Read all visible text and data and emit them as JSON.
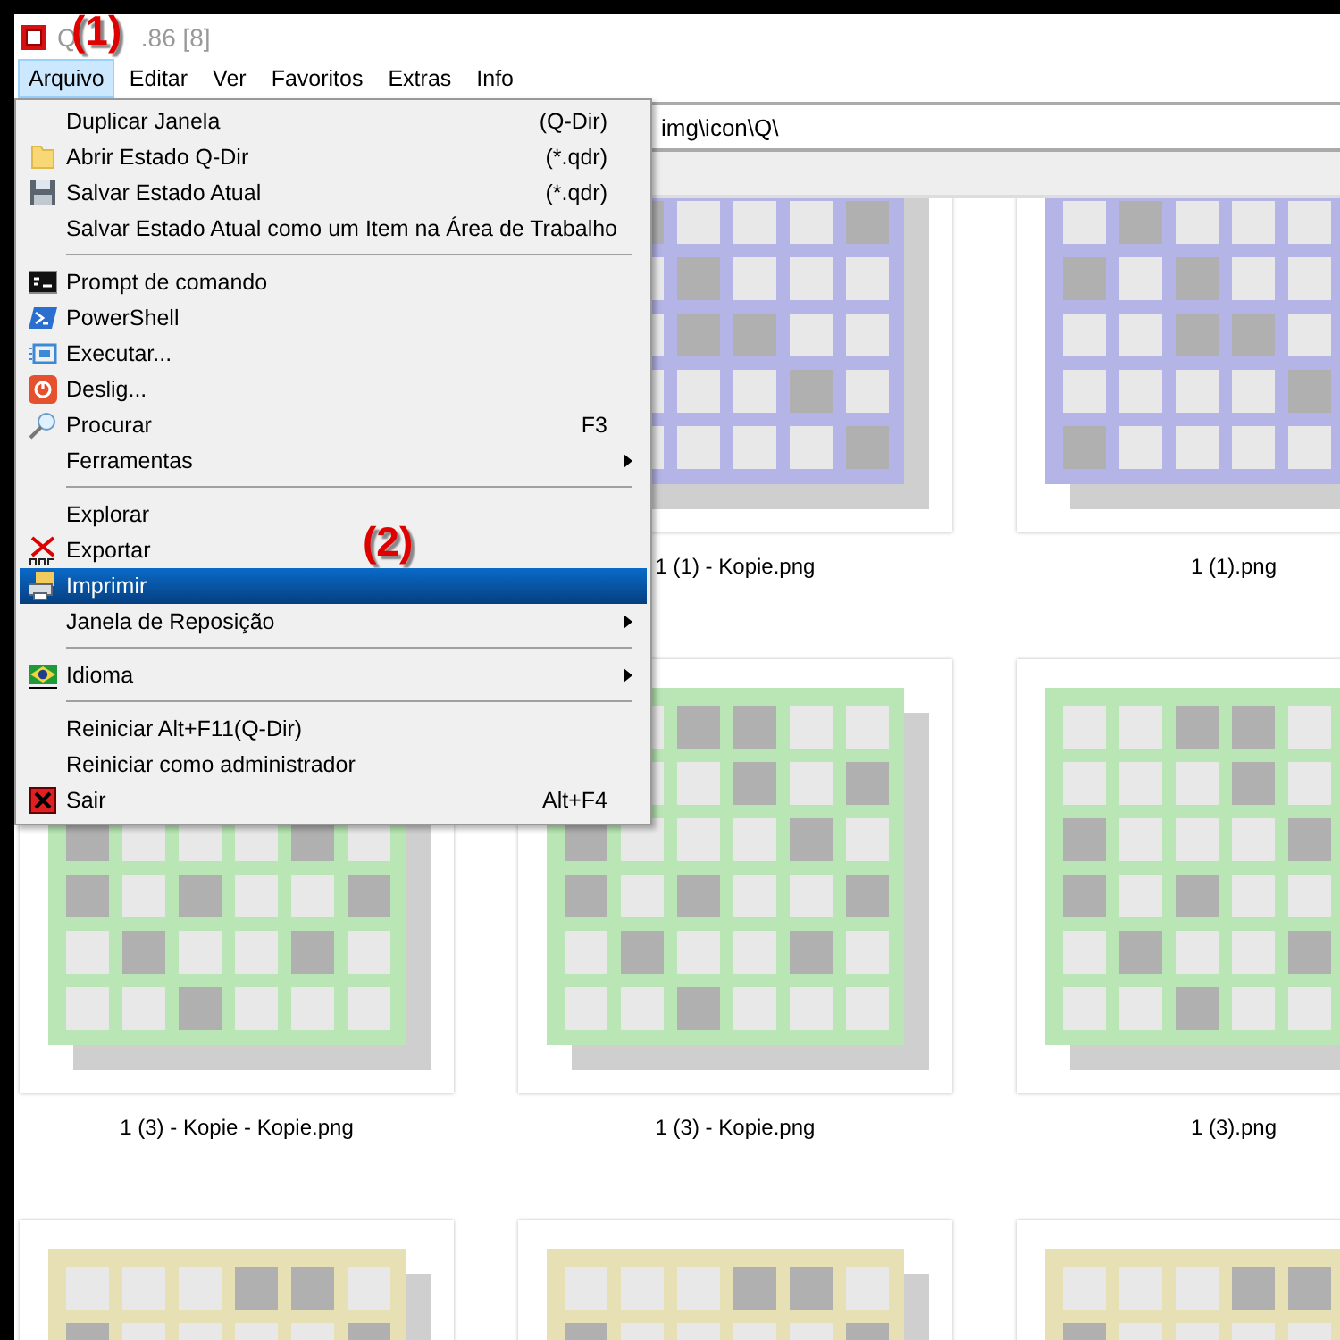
{
  "window": {
    "title_start": "Q",
    "title_end": ".86 [8]"
  },
  "menu_bar": [
    {
      "label": "Arquivo",
      "selected": true
    },
    {
      "label": "Editar",
      "selected": false
    },
    {
      "label": "Ver",
      "selected": false
    },
    {
      "label": "Favoritos",
      "selected": false
    },
    {
      "label": "Extras",
      "selected": false
    },
    {
      "label": "Info",
      "selected": false
    }
  ],
  "address_bar": {
    "value": "img\\icon\\Q\\"
  },
  "file_menu": [
    {
      "kind": "item",
      "label": "Duplicar Janela",
      "shortcut": "(Q-Dir)",
      "selected": false
    },
    {
      "kind": "item",
      "label": "Abrir Estado Q-Dir",
      "shortcut": "(*.qdr)",
      "selected": false
    },
    {
      "kind": "item",
      "label": "Salvar Estado Atual",
      "shortcut": "(*.qdr)",
      "selected": false
    },
    {
      "kind": "item",
      "label": "Salvar Estado Atual como um Item na Área de Trabalho",
      "selected": false
    },
    {
      "kind": "separator"
    },
    {
      "kind": "item",
      "label": "Prompt de comando",
      "selected": false
    },
    {
      "kind": "item",
      "label": "PowerShell",
      "selected": false
    },
    {
      "kind": "item",
      "label": "Executar...",
      "selected": false
    },
    {
      "kind": "item",
      "label": "Deslig...",
      "selected": false
    },
    {
      "kind": "item",
      "label": "Procurar",
      "shortcut": "F3",
      "selected": false
    },
    {
      "kind": "item",
      "label": "Ferramentas",
      "submenu": true,
      "selected": false
    },
    {
      "kind": "separator"
    },
    {
      "kind": "item",
      "label": "Explorar",
      "selected": false
    },
    {
      "kind": "item",
      "label": "Exportar",
      "selected": false
    },
    {
      "kind": "item",
      "label": "Imprimir",
      "selected": true
    },
    {
      "kind": "item",
      "label": "Janela de Reposição",
      "submenu": true,
      "selected": false
    },
    {
      "kind": "separator"
    },
    {
      "kind": "item",
      "label": "Idioma",
      "submenu": true,
      "selected": false
    },
    {
      "kind": "separator"
    },
    {
      "kind": "item",
      "label": "Reiniciar Alt+F11(Q-Dir)",
      "selected": false
    },
    {
      "kind": "item",
      "label": "Reiniciar como administrador",
      "selected": false
    },
    {
      "kind": "item",
      "label": "Sair",
      "shortcut": "Alt+F4",
      "selected": false
    }
  ],
  "thumbnails": [
    [
      {
        "label": "1 (1) - Kopie.png",
        "color": "#b4b4e6"
      },
      {
        "label": "1 (1).png",
        "color": "#b4b4e6"
      }
    ],
    [
      {
        "label": "1 (3) - Kopie - Kopie.png",
        "color": "#b9e6b4"
      },
      {
        "label": "1 (3) - Kopie.png",
        "color": "#b9e6b4"
      },
      {
        "label": "1 (3).png",
        "color": "#b9e6b4"
      }
    ],
    [
      {
        "color": "#e6e0b4"
      },
      {
        "color": "#e6e0b4"
      },
      {
        "color": "#e6e0b4"
      }
    ]
  ],
  "annotations": [
    "(1)",
    "(2)"
  ]
}
